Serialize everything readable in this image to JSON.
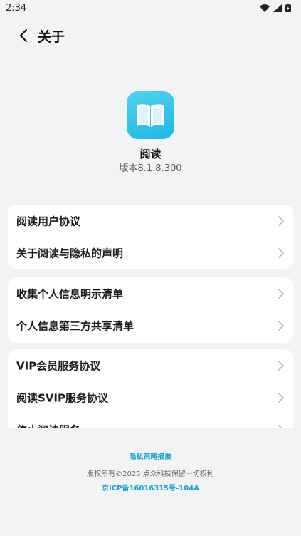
{
  "status": {
    "time": "2:34"
  },
  "header": {
    "title": "关于"
  },
  "app": {
    "name": "阅读",
    "version": "版本8.1.8.300"
  },
  "groups": [
    {
      "items": [
        {
          "label": "阅读用户协议"
        },
        {
          "label": "关于阅读与隐私的声明"
        }
      ]
    },
    {
      "items": [
        {
          "label": "收集个人信息明示清单"
        },
        {
          "label": "个人信息第三方共享清单"
        }
      ]
    },
    {
      "items": [
        {
          "label": "VIP会员服务协议"
        },
        {
          "label": "阅读SVIP服务协议"
        },
        {
          "label": "停止阅读服务"
        }
      ]
    }
  ],
  "footer": {
    "privacy_summary": "隐私策略摘要",
    "copyright": "版权所有©2025 点众科技保留一切权利",
    "icp": "京ICP备16016315号-104A"
  },
  "colors": {
    "accent": "#1aa0d8",
    "background": "#f1f3f5",
    "icon_gradient": "#1fb7e4"
  }
}
